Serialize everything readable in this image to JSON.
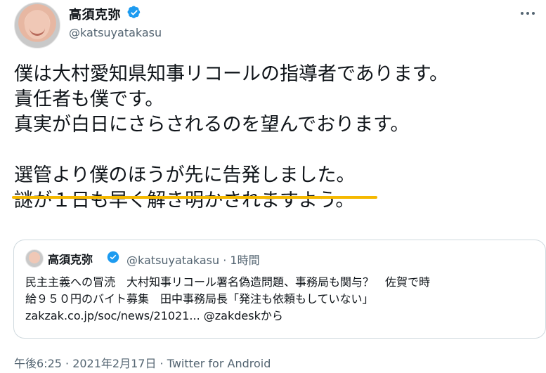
{
  "author": {
    "name": "高須克弥",
    "handle": "@katsuyatakasu",
    "verified": true
  },
  "tweet": {
    "lines": [
      "僕は大村愛知県知事リコールの指導者であります。",
      "責任者も僕です。",
      "真実が白日にさらされるのを望んでおります。",
      "",
      "選管より僕のほうが先に告発しました。",
      "謎が１日も早く解き明かされますよう。"
    ],
    "highlight_color": "#f5b800"
  },
  "quoted": {
    "name": "高須克弥",
    "handle": "@katsuyatakasu",
    "time": "· 1時間",
    "text_lines": [
      "民主主義への冒涜　大村知事リコール署名偽造問題、事務局も関与？　佐賀で時",
      "給９５０円のバイト募集　田中事務局長「発注も依頼もしていない」",
      "zakzak.co.jp/soc/news/21021... @zakdeskから"
    ]
  },
  "footer": {
    "meta": "午後6:25 · 2021年2月17日 · Twitter for Android"
  },
  "colors": {
    "verified": "#1d9bf0",
    "secondary_text": "#536471",
    "border": "#cfd9de"
  },
  "icons": {
    "more": "more-icon",
    "verified": "verified-badge-icon"
  }
}
